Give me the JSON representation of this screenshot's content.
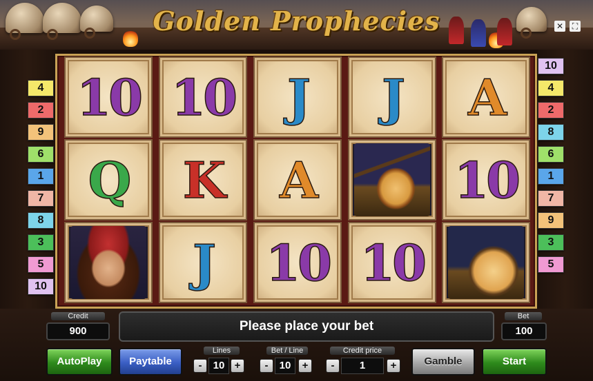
{
  "title": "Golden Prophecies",
  "left_lines": [
    {
      "n": "4",
      "color": "#f5e86a"
    },
    {
      "n": "2",
      "color": "#ee6a6a"
    },
    {
      "n": "9",
      "color": "#f3c27a"
    },
    {
      "n": "6",
      "color": "#9fe06a"
    },
    {
      "n": "1",
      "color": "#5aa6ea"
    },
    {
      "n": "7",
      "color": "#f0b6a6"
    },
    {
      "n": "8",
      "color": "#7dd4ea"
    },
    {
      "n": "3",
      "color": "#4cbf5a"
    },
    {
      "n": "5",
      "color": "#f09ad2"
    },
    {
      "n": "10",
      "color": "#e0c2f0"
    }
  ],
  "right_lines": [
    {
      "n": "10",
      "color": "#e0c2f0"
    },
    {
      "n": "4",
      "color": "#f5e86a"
    },
    {
      "n": "2",
      "color": "#ee6a6a"
    },
    {
      "n": "8",
      "color": "#7dd4ea"
    },
    {
      "n": "6",
      "color": "#9fe06a"
    },
    {
      "n": "1",
      "color": "#5aa6ea"
    },
    {
      "n": "7",
      "color": "#f0b6a6"
    },
    {
      "n": "9",
      "color": "#f3c27a"
    },
    {
      "n": "3",
      "color": "#4cbf5a"
    },
    {
      "n": "5",
      "color": "#f09ad2"
    }
  ],
  "reels": [
    [
      {
        "s": "10",
        "c": "#8a3aa8",
        "kind": "text"
      },
      {
        "s": "Q",
        "c": "#3aa84a",
        "kind": "text"
      },
      {
        "s": "gypsy-woman",
        "kind": "pic"
      }
    ],
    [
      {
        "s": "10",
        "c": "#8a3aa8",
        "kind": "text"
      },
      {
        "s": "K",
        "c": "#c83028",
        "kind": "text"
      },
      {
        "s": "J",
        "c": "#2a8ac8",
        "kind": "text"
      }
    ],
    [
      {
        "s": "J",
        "c": "#2a8ac8",
        "kind": "text"
      },
      {
        "s": "A",
        "c": "#e08a2a",
        "kind": "text"
      },
      {
        "s": "10",
        "c": "#8a3aa8",
        "kind": "text"
      }
    ],
    [
      {
        "s": "J",
        "c": "#2a8ac8",
        "kind": "text"
      },
      {
        "s": "mandolin",
        "kind": "pic"
      },
      {
        "s": "10",
        "c": "#8a3aa8",
        "kind": "text"
      }
    ],
    [
      {
        "s": "A",
        "c": "#e08a2a",
        "kind": "text"
      },
      {
        "s": "10",
        "c": "#8a3aa8",
        "kind": "text"
      },
      {
        "s": "drum",
        "kind": "pic"
      }
    ]
  ],
  "credit": {
    "label": "Credit",
    "value": "900"
  },
  "bet": {
    "label": "Bet",
    "value": "100"
  },
  "message": "Please place your bet",
  "buttons": {
    "autoplay": "AutoPlay",
    "paytable": "Paytable",
    "gamble": "Gamble",
    "start": "Start"
  },
  "lines": {
    "label": "Lines",
    "value": "10"
  },
  "bet_line": {
    "label": "Bet / Line",
    "value": "10"
  },
  "credit_price": {
    "label": "Credit price",
    "value": "1"
  },
  "steppers": {
    "minus": "-",
    "plus": "+"
  },
  "corner_icons": {
    "sound": "✕",
    "fullscreen": "⛶"
  }
}
